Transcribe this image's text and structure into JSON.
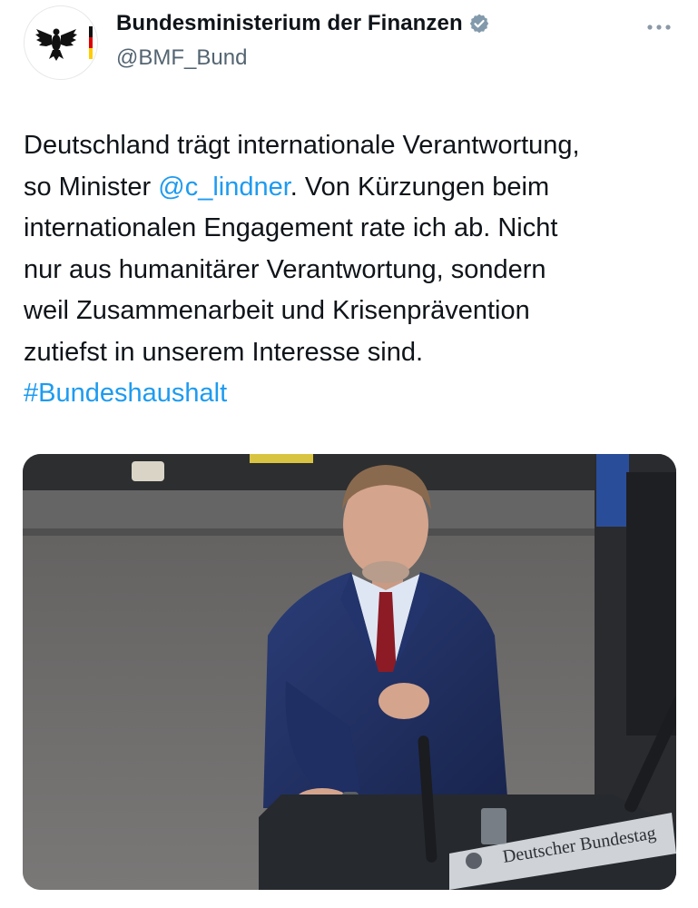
{
  "author": {
    "display_name": "Bundesministerium der Finanzen",
    "handle": "@BMF_Bund",
    "verified": true,
    "avatar_icon": "federal-eagle-logo"
  },
  "tweet": {
    "line1": "Deutschland trägt internationale Verantwortung,",
    "line2_prefix": "so Minister ",
    "mention": "@c_lindner",
    "line2_suffix": ". Von Kürzungen beim",
    "line3": "internationalen Engagement rate ich ab. Nicht",
    "line4": "nur aus humanitärer Verantwortung, sondern",
    "line5": "weil Zusammenarbeit und Krisenprävention",
    "line6": "zutiefst in unserem Interesse sind.",
    "hashtag": "#Bundeshaushalt"
  },
  "media": {
    "lectern_sign": "Deutscher Bundestag"
  },
  "colors": {
    "link": "#1d9bf0",
    "verified_badge": "#829aab",
    "text": "#0f1419",
    "secondary_text": "#536471"
  },
  "icons": {
    "more": "more-options-icon",
    "verified": "verified-badge-icon"
  }
}
